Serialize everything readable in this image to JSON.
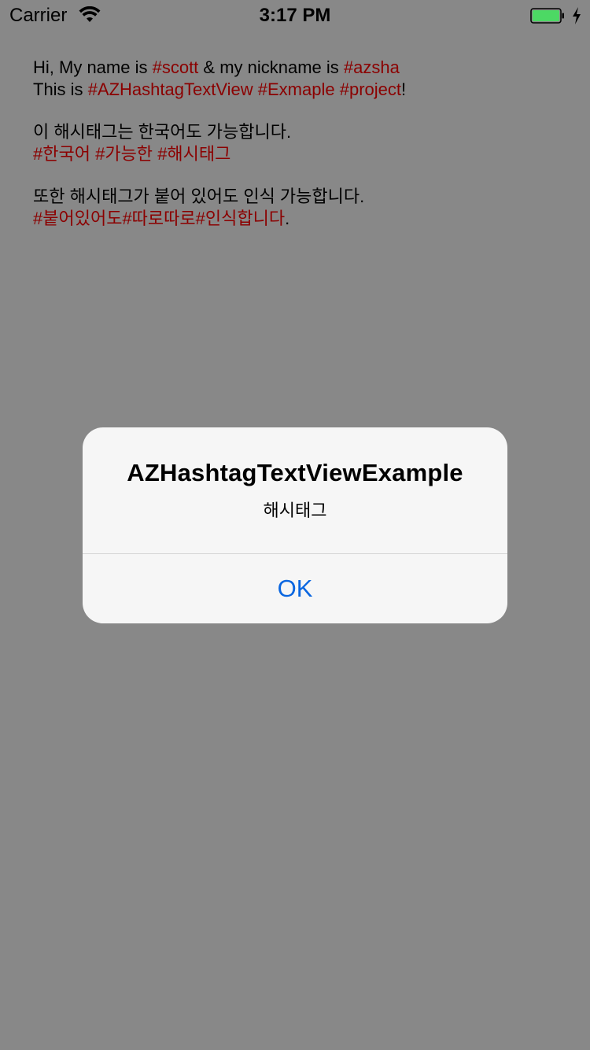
{
  "status_bar": {
    "carrier": "Carrier",
    "time": "3:17 PM",
    "battery_color": "#4cd964",
    "icons": [
      "wifi-icon",
      "battery-icon",
      "charge-icon"
    ]
  },
  "text_view": {
    "line1": {
      "t1": "Hi, My name is ",
      "tag1": "#scott",
      "t2": " & my nickname is ",
      "tag2": "#azsha"
    },
    "line2": {
      "t1": "This is ",
      "tag1": "#AZHashtagTextView",
      "t2": " ",
      "tag2": "#Exmaple",
      "t3": " ",
      "tag3": "#project",
      "t4": "!"
    },
    "line3": "이 해시태그는 한국어도 가능합니다.",
    "line4": {
      "tag1": "#한국어",
      "t1": " ",
      "tag2": "#가능한",
      "t2": " ",
      "tag3": "#해시태그"
    },
    "line5": "또한 해시태그가 붙어 있어도 인식 가능합니다.",
    "line6": {
      "tag1": "#붙어있어도",
      "tag2": "#따로따로",
      "tag3": "#인식합니다",
      "t1": "."
    },
    "text_color": "#000000",
    "hashtag_color": "#8b0000"
  },
  "alert": {
    "title": "AZHashtagTextViewExample",
    "message": "해시태그",
    "button_label": "OK",
    "button_color": "#0a66e0"
  }
}
